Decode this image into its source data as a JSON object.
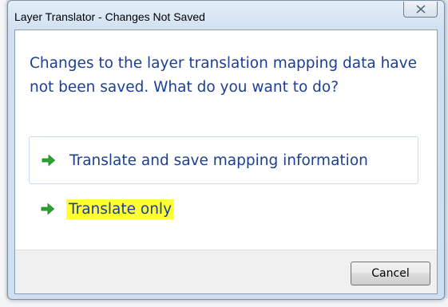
{
  "dialog": {
    "title": "Layer Translator - Changes Not Saved",
    "close_icon": "close-icon",
    "instruction": "Changes to the layer translation mapping data have not been saved. What do you want to do?",
    "commands": [
      {
        "label": "Translate and save mapping information",
        "icon": "green-arrow-icon",
        "selected": true
      },
      {
        "label": "Translate only",
        "icon": "green-arrow-icon",
        "highlighted": true,
        "highlight_color": "#ffff33"
      }
    ],
    "cancel_label": "Cancel"
  },
  "colors": {
    "instruction_text": "#1c3f94",
    "arrow_green": "#2aa52a",
    "highlight": "#ffff33"
  }
}
